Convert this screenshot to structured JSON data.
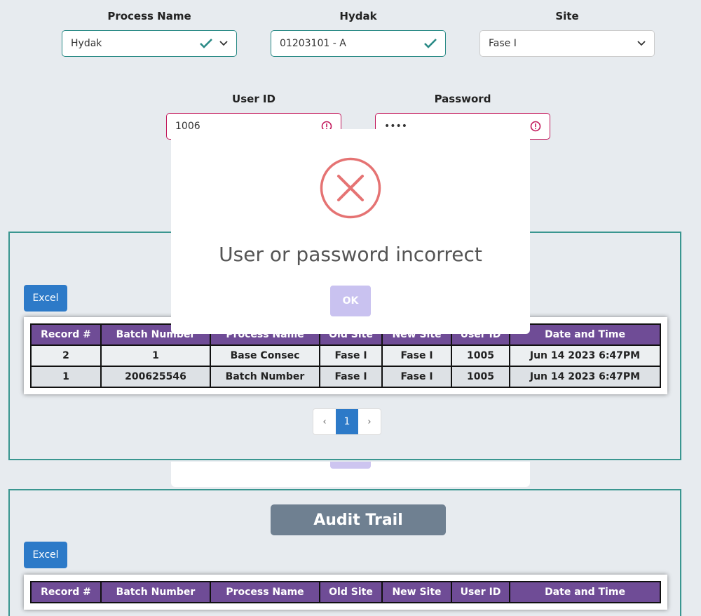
{
  "form": {
    "process_name": {
      "label": "Process Name",
      "value": "Hydak"
    },
    "hydak": {
      "label": "Hydak",
      "value": "01203101 - A"
    },
    "site": {
      "label": "Site",
      "value": "Fase I"
    },
    "user_id": {
      "label": "User ID",
      "value": "1006"
    },
    "password": {
      "label": "Password",
      "value": "••••"
    }
  },
  "records_panel": {
    "excel_label": "Excel",
    "columns": [
      "Record #",
      "Batch Number",
      "Process Name",
      "Old Site",
      "New Site",
      "User ID",
      "Date and Time"
    ],
    "rows": [
      [
        "2",
        "1",
        "Base Consec",
        "Fase I",
        "Fase I",
        "1005",
        "Jun 14 2023 6:47PM"
      ],
      [
        "1",
        "200625546",
        "Batch Number",
        "Fase I",
        "Fase I",
        "1005",
        "Jun 14 2023 6:47PM"
      ]
    ],
    "pagination": {
      "prev": "‹",
      "current": "1",
      "next": "›"
    }
  },
  "audit_panel": {
    "title": "Audit Trail",
    "excel_label": "Excel",
    "columns": [
      "Record #",
      "Batch Number",
      "Process Name",
      "Old Site",
      "New Site",
      "User ID",
      "Date and Time"
    ]
  },
  "modal": {
    "message": "User or password incorrect",
    "ok_label": "OK",
    "icon": "error-x-circle-icon"
  },
  "colors": {
    "accent_valid": "#2a8a86",
    "accent_invalid": "#c2185b",
    "table_header": "#6f4c96",
    "button_primary": "#2d7ac8",
    "error_icon": "#e57373"
  }
}
